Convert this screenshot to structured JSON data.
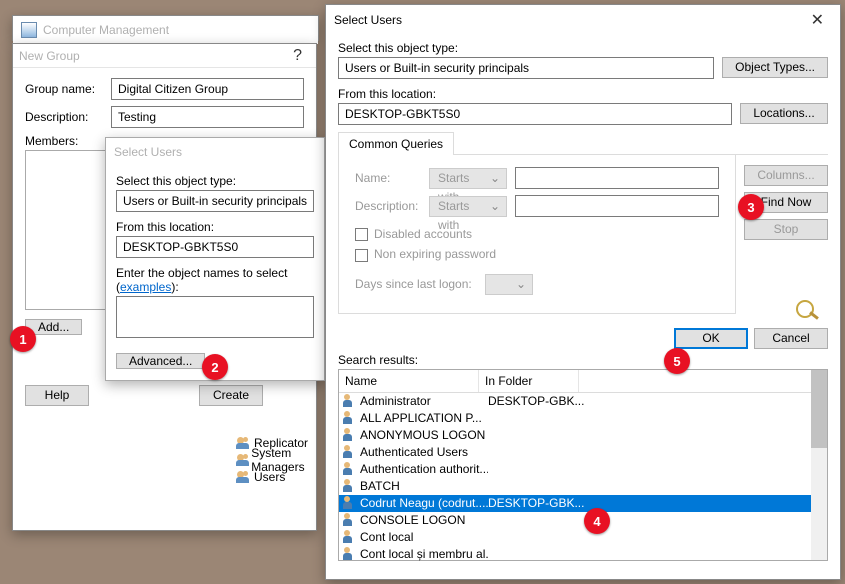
{
  "mgmt": {
    "title": "Computer Management"
  },
  "newgrp": {
    "title": "New Group",
    "labels": {
      "groupname": "Group name:",
      "description": "Description:",
      "members": "Members:"
    },
    "values": {
      "groupname": "Digital Citizen Group",
      "description": "Testing"
    },
    "buttons": {
      "add": "Add...",
      "help": "Help",
      "create": "Create"
    },
    "tree": [
      "Replicator",
      "System Managers",
      "Users"
    ]
  },
  "select1": {
    "title": "Select Users",
    "labels": {
      "objtype": "Select this object type:",
      "location": "From this location:",
      "enter": "Enter the object names to select (",
      "examples": "examples",
      "enter2": "):"
    },
    "values": {
      "objtype": "Users or Built-in security principals",
      "location": "DESKTOP-GBKT5S0"
    },
    "buttons": {
      "advanced": "Advanced..."
    }
  },
  "select2": {
    "title": "Select Users",
    "labels": {
      "objtype": "Select this object type:",
      "location": "From this location:",
      "tab": "Common Queries",
      "name": "Name:",
      "desc": "Description:",
      "startswith": "Starts with",
      "disabled": "Disabled accounts",
      "nonexp": "Non expiring password",
      "days": "Days since last logon:",
      "results": "Search results:"
    },
    "values": {
      "objtype": "Users or Built-in security principals",
      "location": "DESKTOP-GBKT5S0"
    },
    "buttons": {
      "objtypes": "Object Types...",
      "locations": "Locations...",
      "columns": "Columns...",
      "findnow": "Find Now",
      "stop": "Stop",
      "ok": "OK",
      "cancel": "Cancel"
    },
    "cols": {
      "name": "Name",
      "folder": "In Folder"
    },
    "rows": [
      {
        "name": "Administrator",
        "folder": "DESKTOP-GBK...",
        "selected": false
      },
      {
        "name": "ALL APPLICATION P...",
        "folder": "",
        "selected": false
      },
      {
        "name": "ANONYMOUS LOGON",
        "folder": "",
        "selected": false
      },
      {
        "name": "Authenticated Users",
        "folder": "",
        "selected": false
      },
      {
        "name": "Authentication authorit...",
        "folder": "",
        "selected": false
      },
      {
        "name": "BATCH",
        "folder": "",
        "selected": false
      },
      {
        "name": "Codrut Neagu (codrut....",
        "folder": "DESKTOP-GBK...",
        "selected": true
      },
      {
        "name": "CONSOLE LOGON",
        "folder": "",
        "selected": false
      },
      {
        "name": "Cont local",
        "folder": "",
        "selected": false
      },
      {
        "name": "Cont local și membru al...",
        "folder": "",
        "selected": false
      }
    ]
  },
  "badges": {
    "b1": "1",
    "b2": "2",
    "b3": "3",
    "b4": "4",
    "b5": "5"
  }
}
